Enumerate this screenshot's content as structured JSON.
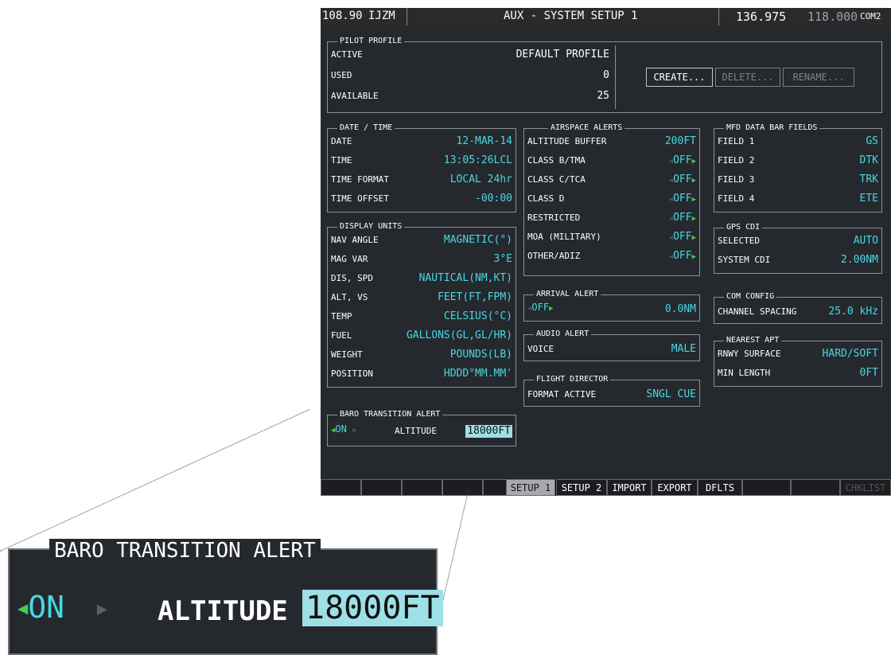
{
  "topbar": {
    "nav": "108.90",
    "ident": "IJZM",
    "title": "AUX - SYSTEM SETUP 1",
    "com_active": "136.975",
    "com_standby": "118.000",
    "com_label": "COM2"
  },
  "pilot_profile": {
    "title": "PILOT PROFILE",
    "active_label": "ACTIVE",
    "active_value": "DEFAULT PROFILE",
    "used_label": "USED",
    "used_value": "0",
    "available_label": "AVAILABLE",
    "available_value": "25",
    "create": "CREATE...",
    "delete": "DELETE...",
    "rename": "RENAME..."
  },
  "date_time": {
    "title": "DATE / TIME",
    "rows": [
      [
        "DATE",
        "12-MAR-14"
      ],
      [
        "TIME",
        "13:05:26LCL"
      ],
      [
        "TIME FORMAT",
        "LOCAL 24hr"
      ],
      [
        "TIME OFFSET",
        "-00:00"
      ]
    ]
  },
  "display_units": {
    "title": "DISPLAY UNITS",
    "rows": [
      [
        "NAV ANGLE",
        "MAGNETIC(°)"
      ],
      [
        "MAG VAR",
        "3°E"
      ],
      [
        "DIS, SPD",
        "NAUTICAL(NM,KT)"
      ],
      [
        "ALT, VS",
        "FEET(FT,FPM)"
      ],
      [
        "TEMP",
        "CELSIUS(°C)"
      ],
      [
        "FUEL",
        "GALLONS(GL,GL/HR)"
      ],
      [
        "WEIGHT",
        "POUNDS(LB)"
      ],
      [
        "POSITION",
        "HDDD°MM.MM'"
      ]
    ]
  },
  "baro": {
    "title": "BARO TRANSITION ALERT",
    "state": "ON",
    "alt_label": "ALTITUDE",
    "alt_value": "18000FT"
  },
  "airspace": {
    "title": "AIRSPACE ALERTS",
    "buffer_label": "ALTITUDE BUFFER",
    "buffer_value": "200FT",
    "rows": [
      [
        "CLASS B/TMA",
        "OFF"
      ],
      [
        "CLASS C/TCA",
        "OFF"
      ],
      [
        "CLASS D",
        "OFF"
      ],
      [
        "RESTRICTED",
        "OFF"
      ],
      [
        "MOA (MILITARY)",
        "OFF"
      ],
      [
        "OTHER/ADIZ",
        "OFF"
      ]
    ]
  },
  "arrival": {
    "title": "ARRIVAL ALERT",
    "state": "OFF",
    "value": "0.0NM"
  },
  "audio": {
    "title": "AUDIO ALERT",
    "label": "VOICE",
    "value": "MALE"
  },
  "fd": {
    "title": "FLIGHT DIRECTOR",
    "label": "FORMAT ACTIVE",
    "value": "SNGL CUE"
  },
  "mfd": {
    "title": "MFD DATA BAR FIELDS",
    "rows": [
      [
        "FIELD 1",
        "GS"
      ],
      [
        "FIELD 2",
        "DTK"
      ],
      [
        "FIELD 3",
        "TRK"
      ],
      [
        "FIELD 4",
        "ETE"
      ]
    ]
  },
  "gps": {
    "title": "GPS CDI",
    "rows": [
      [
        "SELECTED",
        "AUTO"
      ],
      [
        "SYSTEM CDI",
        "2.00NM"
      ]
    ]
  },
  "com": {
    "title": "COM CONFIG",
    "label": "CHANNEL SPACING",
    "value": "25.0 kHz"
  },
  "nearest": {
    "title": "NEAREST APT",
    "rows": [
      [
        "RNWY SURFACE",
        "HARD/SOFT"
      ],
      [
        "MIN LENGTH",
        "0FT"
      ]
    ]
  },
  "softkeys": {
    "setup1": "SETUP 1",
    "setup2": "SETUP 2",
    "import": "IMPORT",
    "export": "EXPORT",
    "dflts": "DFLTS",
    "chklist": "CHKLIST"
  }
}
